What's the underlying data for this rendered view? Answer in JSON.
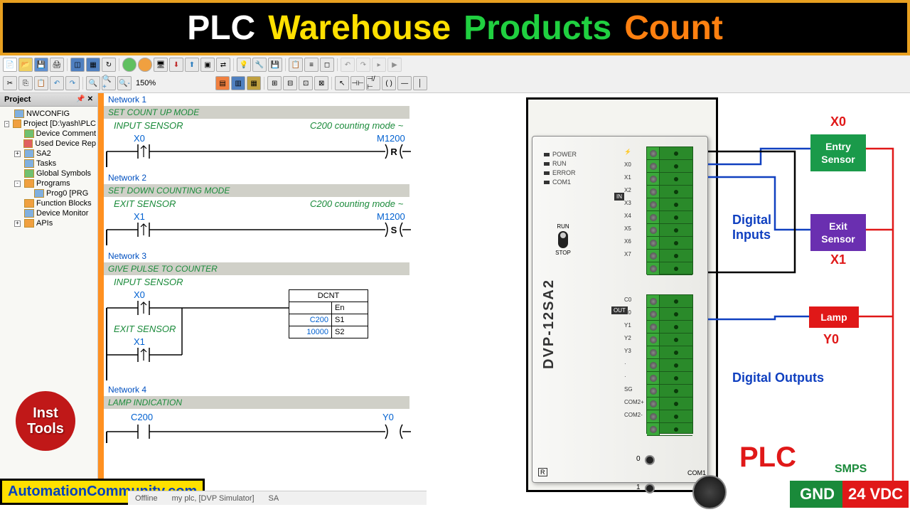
{
  "title": {
    "w1": "PLC",
    "w2": "Warehouse",
    "w3": "Products",
    "w4": "Count",
    "c1": "#ffffff",
    "c2": "#ffe000",
    "c3": "#20d040",
    "c4": "#ff8010"
  },
  "zoom": "150%",
  "project": {
    "header": "Project",
    "items": [
      {
        "label": "NWCONFIG",
        "cls": "cfg",
        "lvl": 0
      },
      {
        "label": "Project [D:\\yash\\PLC",
        "cls": "prg",
        "lvl": 0,
        "exp": "-"
      },
      {
        "label": "Device Comment",
        "cls": "grn",
        "lvl": 1
      },
      {
        "label": "Used Device Rep",
        "cls": "red",
        "lvl": 1
      },
      {
        "label": "SA2",
        "cls": "cfg",
        "lvl": 1,
        "exp": "+"
      },
      {
        "label": "Tasks",
        "cls": "cfg",
        "lvl": 1
      },
      {
        "label": "Global Symbols",
        "cls": "grn",
        "lvl": 1
      },
      {
        "label": "Programs",
        "cls": "prg",
        "lvl": 1,
        "exp": "-"
      },
      {
        "label": "Prog0 [PRG",
        "cls": "cfg",
        "lvl": 2
      },
      {
        "label": "Function Blocks",
        "cls": "prg",
        "lvl": 1
      },
      {
        "label": "Device Monitor",
        "cls": "cfg",
        "lvl": 1
      },
      {
        "label": "APIs",
        "cls": "prg",
        "lvl": 1,
        "exp": "+"
      }
    ]
  },
  "networks": [
    {
      "num": "Network 1",
      "title": "SET COUNT UP MODE",
      "leftLabel": "INPUT SENSOR",
      "leftAddr": "X0",
      "rightLabel": "C200 counting mode ~",
      "rightAddr": "M1200",
      "coil": "R"
    },
    {
      "num": "Network 2",
      "title": "SET DOWN COUNTING MODE",
      "leftLabel": "EXIT SENSOR",
      "leftAddr": "X1",
      "rightLabel": "C200 counting mode ~",
      "rightAddr": "M1200",
      "coil": "S"
    },
    {
      "num": "Network 3",
      "title": "GIVE PULSE TO COUNTER",
      "leftLabel": "INPUT SENSOR",
      "leftAddr": "X0",
      "leftLabel2": "EXIT SENSOR",
      "leftAddr2": "X1",
      "inst": {
        "name": "DCNT",
        "en": "En",
        "s1": "S1",
        "s2": "S2",
        "s1v": "C200",
        "s2v": "10000"
      }
    },
    {
      "num": "Network 4",
      "title": "LAMP INDICATION",
      "leftAddr": "C200",
      "rightAddr": "Y0",
      "coil": " "
    }
  ],
  "plc": {
    "leds": [
      "POWER",
      "RUN",
      "ERROR",
      "COM1"
    ],
    "run": "RUN",
    "stop": "STOP",
    "model": "DVP-12SA2",
    "pins1": [
      "⚡",
      "X0",
      "X1",
      "X2",
      "X3",
      "X4",
      "X5",
      "X6",
      "X7"
    ],
    "pins2": [
      "C0",
      "Y0",
      "Y1",
      "Y2",
      "Y3",
      "·",
      "·",
      "SG",
      "COM2+",
      "COM2-"
    ],
    "in": "IN",
    "out": "OUT",
    "com1": "COM1",
    "j0": "0",
    "j1": "1",
    "r": "R"
  },
  "labels": {
    "entry": "Entry Sensor",
    "exit": "Exit Sensor",
    "lamp": "Lamp",
    "x0": "X0",
    "x1": "X1",
    "y0": "Y0",
    "di": "Digital Inputs",
    "do": "Digital Outputs",
    "plc": "PLC",
    "smps": "SMPS",
    "inst": "Inst Tools",
    "auto": "AutomationCommunity.com",
    "gnd": "GND",
    "vdc": "24 VDC"
  },
  "status": {
    "offline": "Offline",
    "sim": "my plc, [DVP Simulator]",
    "sa": "SA"
  }
}
